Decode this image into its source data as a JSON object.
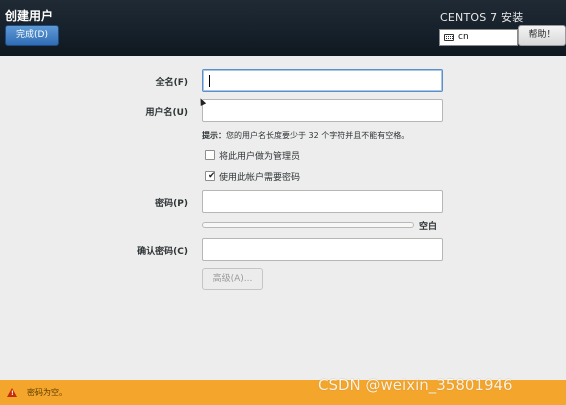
{
  "header": {
    "title": "创建用户",
    "done_label": "完成(D)",
    "product_title": "CENTOS 7 安装",
    "keyboard_layout": "cn",
    "help_label": "帮助！"
  },
  "form": {
    "fullname_label": "全名(F)",
    "fullname_value": "",
    "username_label": "用户名(U)",
    "username_value": "",
    "hint_prefix": "提示：",
    "hint_text": "您的用户名长度要少于 32 个字符并且不能有空格。",
    "admin_checkbox_label": "将此用户做为管理员",
    "admin_checked": false,
    "require_password_label": "使用此帐户需要密码",
    "require_password_checked": true,
    "password_label": "密码(P)",
    "password_value": "",
    "strength_value": 0,
    "strength_label": "空白",
    "confirm_label": "确认密码(C)",
    "confirm_value": "",
    "advanced_label": "高级(A)..."
  },
  "status": {
    "message": "密码为空。",
    "color": "#f4a52b"
  },
  "watermark": "CSDN @weixin_35801946",
  "icons": [
    "keyboard-icon",
    "warning-icon",
    "check-icon"
  ]
}
